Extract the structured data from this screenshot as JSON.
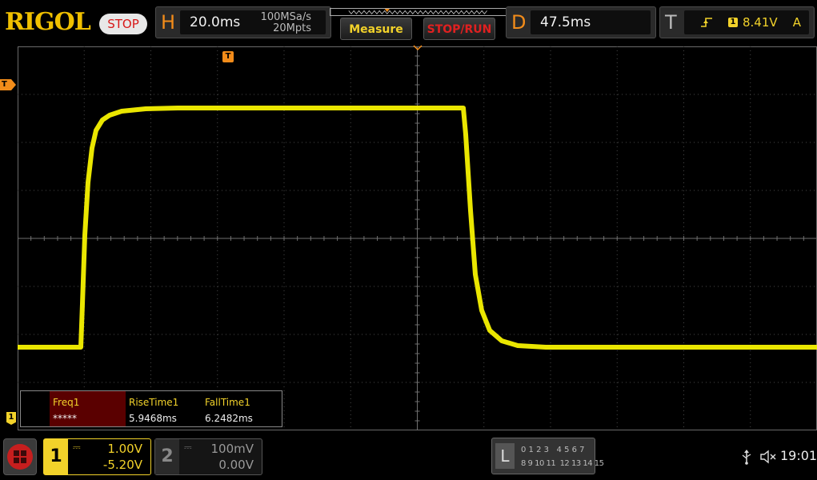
{
  "brand": {
    "logo": "RIGOL",
    "run_state": "STOP"
  },
  "horizontal": {
    "letter": "H",
    "timebase": "20.0ms",
    "sample_rate": "100MSa/s",
    "memory_depth": "20Mpts"
  },
  "buttons": {
    "measure": "Measure",
    "stop_run": "STOP/RUN"
  },
  "delay": {
    "letter": "D",
    "value": "47.5ms"
  },
  "trigger": {
    "letter": "T",
    "source": "1",
    "level": "8.41V",
    "mode": "A"
  },
  "markers": {
    "time_trigger": "T",
    "level_trigger": "T",
    "ch1": "1"
  },
  "measurements": [
    {
      "name": "Freq1",
      "value": "*****"
    },
    {
      "name": "RiseTime1",
      "value": "5.9468ms"
    },
    {
      "name": "FallTime1",
      "value": "6.2482ms"
    }
  ],
  "channels": [
    {
      "number": "1",
      "scale": "1.00V",
      "offset": "-5.20V",
      "color": "#f2e52a",
      "active": true
    },
    {
      "number": "2",
      "scale": "100mV",
      "offset": "0.00V",
      "color": "#888888",
      "active": false
    }
  ],
  "logic_analyzer": {
    "letter": "L",
    "row1": "0 1 2 3   4 5 6 7",
    "row2": "8 9 10 11  12 13 14 15"
  },
  "status": {
    "time": "19:01"
  },
  "colors": {
    "trace": "#f7f200",
    "accent": "#f2d22a",
    "stop": "#d81818",
    "trigger_marker": "#f28c1a"
  }
}
